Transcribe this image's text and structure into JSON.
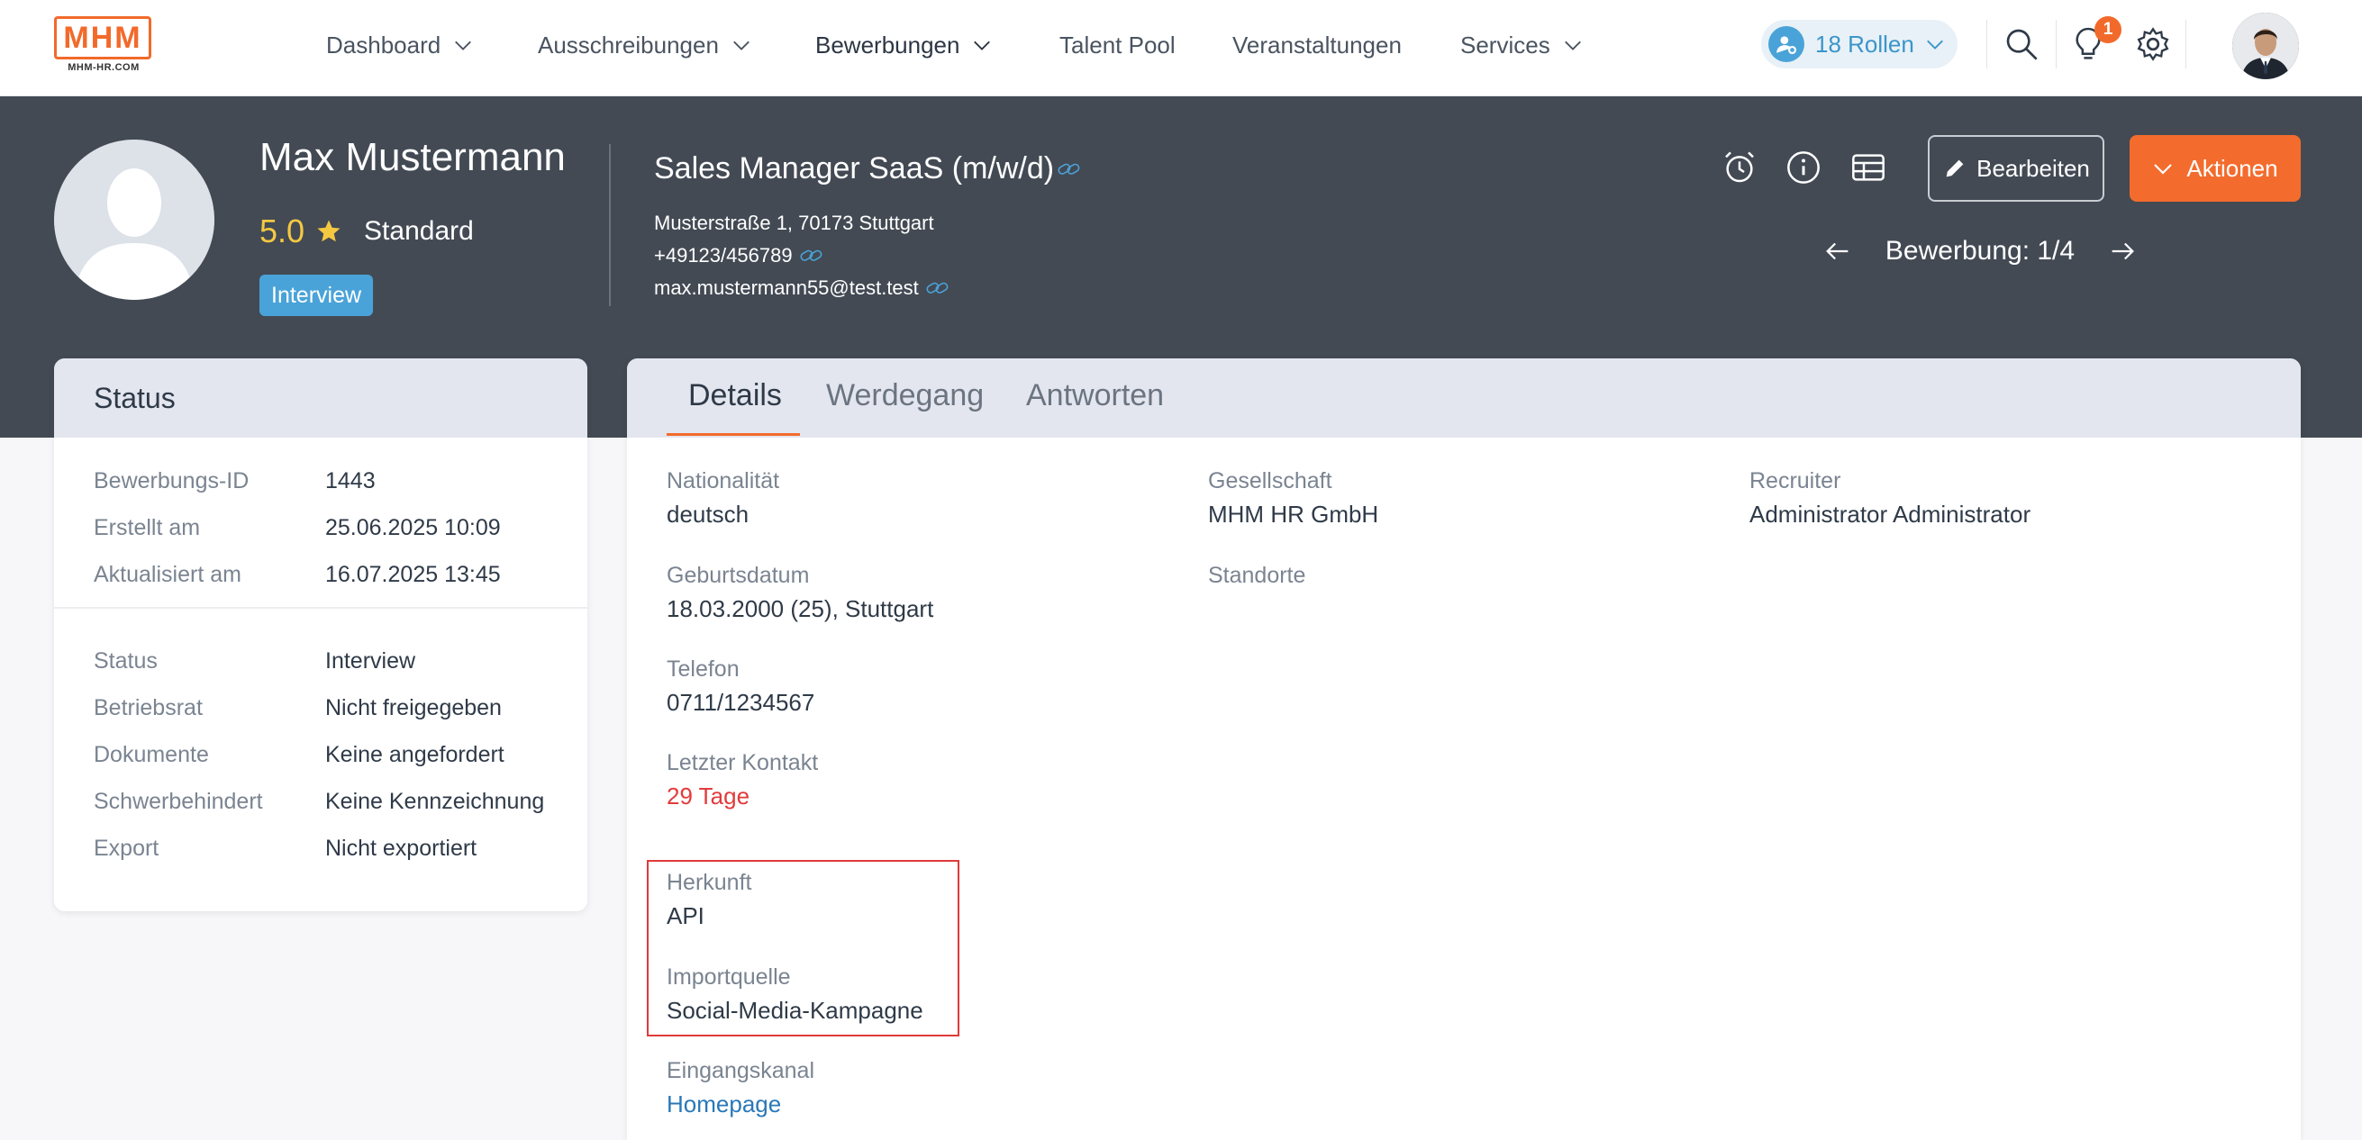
{
  "nav": {
    "logo": "MHM",
    "logo_sub": "MHM-HR.COM",
    "items": [
      {
        "label": "Dashboard"
      },
      {
        "label": "Ausschreibungen"
      },
      {
        "label": "Bewerbungen"
      },
      {
        "label": "Talent Pool"
      },
      {
        "label": "Veranstaltungen"
      },
      {
        "label": "Services"
      }
    ],
    "roles": "18 Rollen",
    "notification_count": "1",
    "icons": [
      "search-icon",
      "lightbulb-icon",
      "gear-icon"
    ]
  },
  "candidate": {
    "name": "Max Mustermann",
    "rating": "5.0",
    "rating_label": "Standard",
    "stage": "Interview",
    "job_title": "Sales Manager SaaS (m/w/d)",
    "address": "Musterstraße 1, 70173 Stuttgart",
    "phone": "+49123/456789",
    "email": "max.mustermann55@test.test"
  },
  "actions": {
    "icons": [
      "alarm-clock-icon",
      "info-icon",
      "table-icon"
    ],
    "edit": "Bearbeiten",
    "actions": "Aktionen",
    "pager": "Bewerbung: 1/4"
  },
  "status": {
    "title": "Status",
    "rows_top": [
      {
        "k": "Bewerbungs-ID",
        "v": "1443"
      },
      {
        "k": "Erstellt am",
        "v": "25.06.2025 10:09"
      },
      {
        "k": "Aktualisiert am",
        "v": "16.07.2025 13:45"
      }
    ],
    "rows_bottom": [
      {
        "k": "Status",
        "v": "Interview"
      },
      {
        "k": "Betriebsrat",
        "v": "Nicht freigegeben"
      },
      {
        "k": "Dokumente",
        "v": "Keine angefordert"
      },
      {
        "k": "Schwerbehindert",
        "v": "Keine Kennzeichnung"
      },
      {
        "k": "Export",
        "v": "Nicht exportiert"
      }
    ]
  },
  "details": {
    "tabs": [
      "Details",
      "Werdegang",
      "Antworten"
    ],
    "col1": [
      {
        "k": "Nationalität",
        "v": "deutsch"
      },
      {
        "k": "Geburtsdatum",
        "v": "18.03.2000 (25), Stuttgart"
      },
      {
        "k": "Telefon",
        "v": "0711/1234567"
      },
      {
        "k": "Letzter Kontakt",
        "v": "29 Tage"
      },
      {
        "k": "Herkunft",
        "v": "API"
      },
      {
        "k": "Importquelle",
        "v": "Social-Media-Kampagne"
      },
      {
        "k": "Eingangskanal",
        "v": "Homepage"
      }
    ],
    "col2": [
      {
        "k": "Gesellschaft",
        "v": "MHM HR GmbH"
      },
      {
        "k": "Standorte",
        "v": ""
      }
    ],
    "col3": [
      {
        "k": "Recruiter",
        "v": "Administrator Administrator"
      }
    ]
  },
  "colors": {
    "accent": "#f36c2d",
    "header_bg": "#434a54",
    "info_blue": "#4aa3d8",
    "alert_red": "#e23b3b",
    "link_blue": "#2a78b8"
  }
}
